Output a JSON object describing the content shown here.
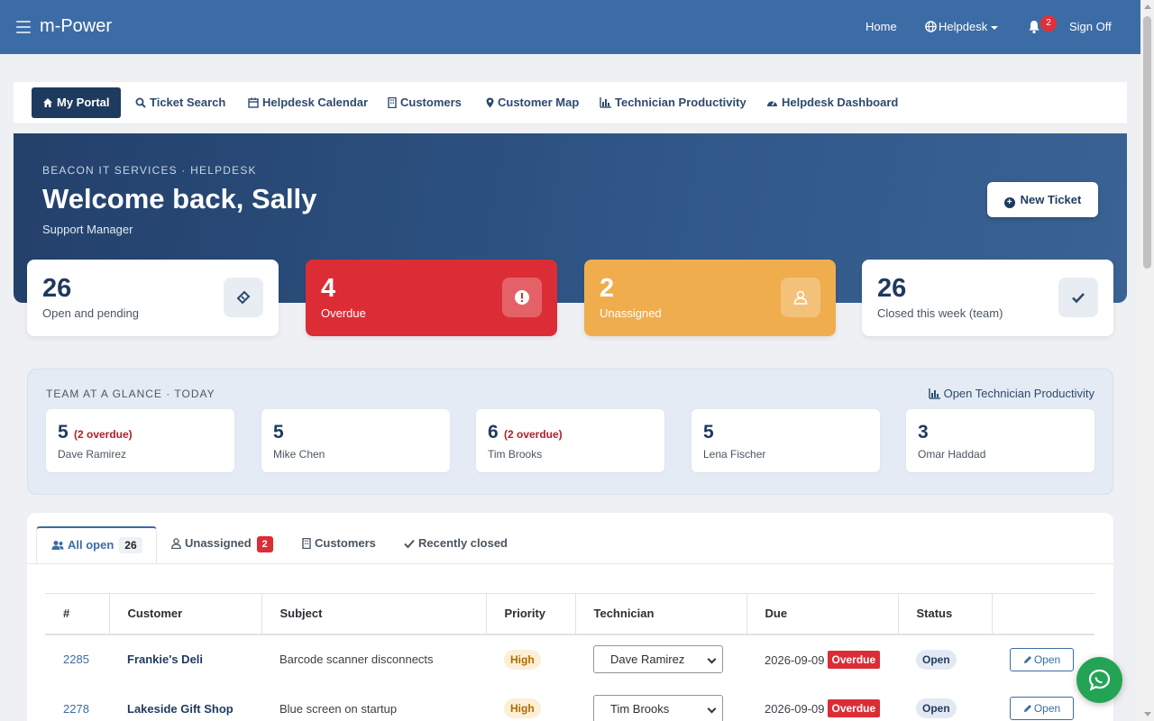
{
  "app": {
    "brand": "m-Power"
  },
  "topnav": {
    "home": "Home",
    "helpdesk": "Helpdesk",
    "notifications": "2",
    "signoff": "Sign Off"
  },
  "subnav": [
    {
      "label": "My Portal",
      "icon": "home-icon",
      "active": true
    },
    {
      "label": "Ticket Search",
      "icon": "search-icon"
    },
    {
      "label": "Helpdesk Calendar",
      "icon": "calendar-icon"
    },
    {
      "label": "Customers",
      "icon": "building-icon"
    },
    {
      "label": "Customer Map",
      "icon": "map-marker-icon"
    },
    {
      "label": "Technician Productivity",
      "icon": "bar-chart-icon"
    },
    {
      "label": "Helpdesk Dashboard",
      "icon": "dashboard-icon"
    }
  ],
  "hero": {
    "kicker": "BEACON IT SERVICES · HELPDESK",
    "title": "Welcome back, Sally",
    "subtitle": "Support Manager",
    "new_ticket": "New Ticket"
  },
  "stats": [
    {
      "value": "26",
      "label": "Open and pending",
      "icon": "ticket-icon"
    },
    {
      "value": "4",
      "label": "Overdue",
      "icon": "exclamation-icon",
      "color": "#dc2d36"
    },
    {
      "value": "2",
      "label": "Unassigned",
      "icon": "user-icon",
      "color": "#f0ad4e"
    },
    {
      "value": "26",
      "label": "Closed this week (team)",
      "icon": "check-icon"
    }
  ],
  "team": {
    "title": "TEAM AT A GLANCE · TODAY",
    "link": "Open Technician Productivity",
    "members": [
      {
        "count": "5",
        "overdue": "(2 overdue)",
        "name": "Dave Ramirez"
      },
      {
        "count": "5",
        "overdue": "",
        "name": "Mike Chen"
      },
      {
        "count": "6",
        "overdue": "(2 overdue)",
        "name": "Tim Brooks"
      },
      {
        "count": "5",
        "overdue": "",
        "name": "Lena Fischer"
      },
      {
        "count": "3",
        "overdue": "",
        "name": "Omar Haddad"
      }
    ]
  },
  "tabs": [
    {
      "label": "All open",
      "count": "26",
      "icon": "users-icon"
    },
    {
      "label": "Unassigned",
      "count": "2",
      "icon": "user-icon"
    },
    {
      "label": "Customers",
      "icon": "building-icon"
    },
    {
      "label": "Recently closed",
      "icon": "check-icon"
    }
  ],
  "table": {
    "headers": [
      "#",
      "Customer",
      "Subject",
      "Priority",
      "Technician",
      "Due",
      "Status",
      ""
    ],
    "rows": [
      {
        "id": "2285",
        "customer": "Frankie's Deli",
        "subject": "Barcode scanner disconnects",
        "priority": "High",
        "technician": "Dave Ramirez",
        "due": "2026-09-09",
        "due_flag": "Overdue",
        "status": "Open",
        "action": "Open"
      },
      {
        "id": "2278",
        "customer": "Lakeside Gift Shop",
        "subject": "Blue screen on startup",
        "priority": "High",
        "technician": "Tim Brooks",
        "due": "2026-09-09",
        "due_flag": "Overdue",
        "status": "Open",
        "action": "Open"
      }
    ]
  },
  "colors": {
    "navbar": "#3c6ca6",
    "accent": "#1f3a5f",
    "danger": "#dc2d36",
    "warning": "#f0ad4e",
    "chat": "#23a455"
  }
}
